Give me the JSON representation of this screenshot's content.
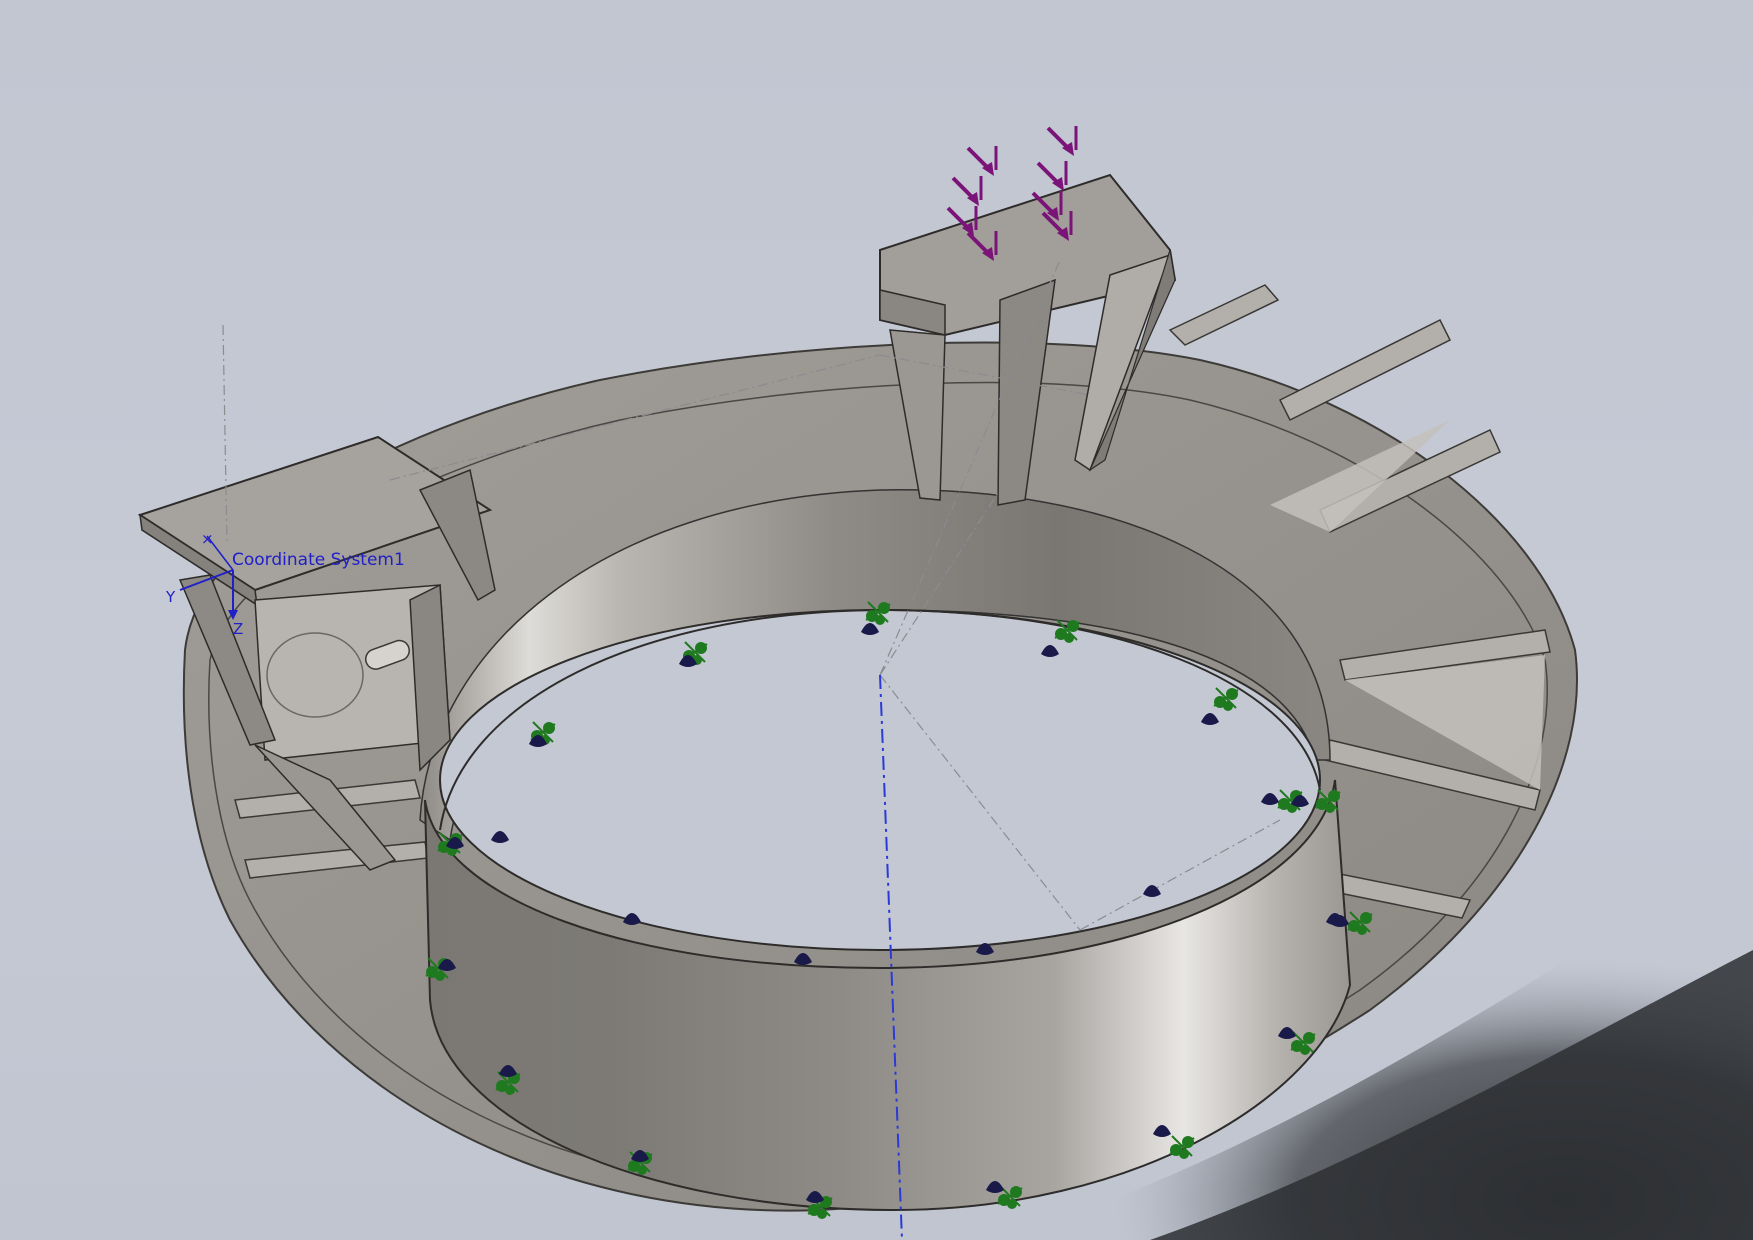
{
  "viewport": {
    "background_color": "#c3c8d3",
    "part_color": "#9c9893",
    "fixture_color": "#1f7a1f",
    "load_color": "#7a1478",
    "axis_color": "#2020c8"
  },
  "coordinate_system": {
    "label": "Coordinate System1",
    "axis_y": "Y",
    "axis_z": "Z",
    "icon": "coordinate-system-triad-icon"
  },
  "fixtures": {
    "icon": "fixed-geometry-arrow-icon",
    "count": 16
  },
  "external_loads": {
    "icon": "force-arrow-icon",
    "count": 8
  },
  "connectors": {
    "icon": "cone-marker-icon",
    "count": 22
  }
}
